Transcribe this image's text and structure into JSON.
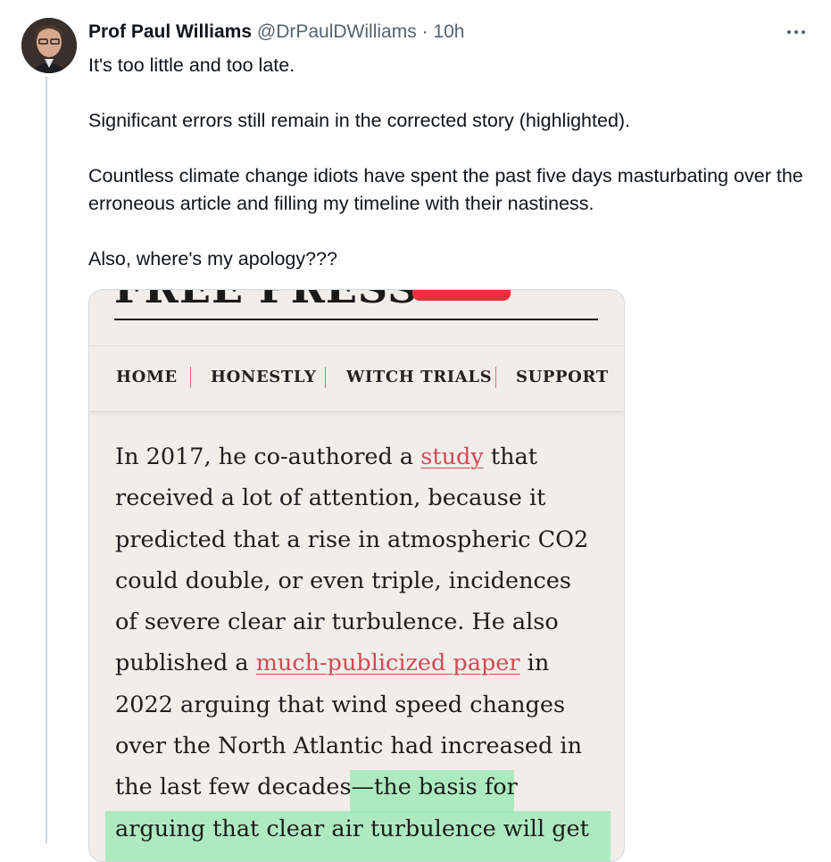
{
  "tweet": {
    "author_name": "Prof Paul Williams",
    "handle": "@DrPaulDWilliams",
    "separator": "·",
    "time": "10h",
    "paragraphs": [
      "It's too little and too late.",
      "Significant errors still remain in the corrected story (highlighted).",
      "Countless climate change idiots have spent the past five days masturbating over the erroneous article and filling my timeline with their nastiness.",
      "Also, where's my apology???"
    ]
  },
  "media": {
    "masthead": "FREE PRESS",
    "nav": [
      "HOME",
      "HONESTLY",
      "WITCH TRIALS",
      "SUPPORT"
    ],
    "article_lines": {
      "l1_before": "In 2017, he co-authored a ",
      "l1_link": "study",
      "l1_after": " that",
      "l2": "received a lot of attention, because it",
      "l3": "predicted that a rise in atmospheric CO2",
      "l4": "could double, or even triple, incidences",
      "l5": "of severe clear air turbulence. He also",
      "l6_before": "published a ",
      "l6_link": "much-publicized paper",
      "l6_after": " in",
      "l7": "2022 arguing that wind speed changes",
      "l8": "over the North Atlantic had increased in",
      "l9_before": "the last few decades",
      "l9_highlight": "—the basis for",
      "l10": "arguing that clear air turbulence will get"
    }
  },
  "colors": {
    "link": "#d24a55",
    "highlight": "#96e8b2",
    "nav_separator": "#e0707a",
    "masthead_button": "#e8303c"
  }
}
